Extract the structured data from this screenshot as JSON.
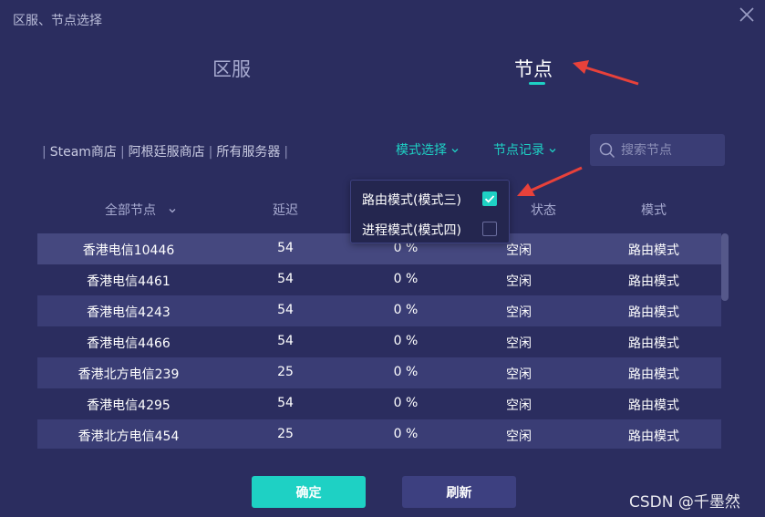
{
  "window": {
    "title": "区服、节点选择"
  },
  "tabs": {
    "region": "区服",
    "node": "节点"
  },
  "stores": {
    "steam": "Steam商店",
    "argentina": "阿根廷服商店",
    "all": "所有服务器",
    "sep": "|"
  },
  "filters": {
    "mode_label": "模式选择",
    "record_label": "节点记录"
  },
  "search": {
    "placeholder": "搜索节点",
    "value": ""
  },
  "table": {
    "headers": {
      "all_nodes": "全部节点",
      "latency": "延迟",
      "status": "状态",
      "mode": "模式"
    },
    "rows": [
      {
        "name": "香港电信10446",
        "latency": "54",
        "loss": "0 %",
        "status": "空闲",
        "mode": "路由模式"
      },
      {
        "name": "香港电信4461",
        "latency": "54",
        "loss": "0 %",
        "status": "空闲",
        "mode": "路由模式"
      },
      {
        "name": "香港电信4243",
        "latency": "54",
        "loss": "0 %",
        "status": "空闲",
        "mode": "路由模式"
      },
      {
        "name": "香港电信4466",
        "latency": "54",
        "loss": "0 %",
        "status": "空闲",
        "mode": "路由模式"
      },
      {
        "name": "香港北方电信239",
        "latency": "25",
        "loss": "0 %",
        "status": "空闲",
        "mode": "路由模式"
      },
      {
        "name": "香港电信4295",
        "latency": "54",
        "loss": "0 %",
        "status": "空闲",
        "mode": "路由模式"
      },
      {
        "name": "香港北方电信454",
        "latency": "25",
        "loss": "0 %",
        "status": "空闲",
        "mode": "路由模式"
      }
    ]
  },
  "mode_dropdown": {
    "items": [
      {
        "label": "路由模式(模式三)",
        "checked": true
      },
      {
        "label": "进程模式(模式四)",
        "checked": false
      }
    ]
  },
  "buttons": {
    "ok": "确定",
    "refresh": "刷新"
  },
  "watermark": "CSDN @千墨然",
  "colors": {
    "background": "#2b2d5f",
    "accent": "#1ed1c4",
    "row_alt": "#3a3d75",
    "annotation_arrow": "#e8413a"
  },
  "icons": {
    "close": "close-icon",
    "search": "search-icon",
    "chevron": "chevron-down-icon",
    "check": "check-icon",
    "arrow": "annotation-arrow-icon"
  }
}
